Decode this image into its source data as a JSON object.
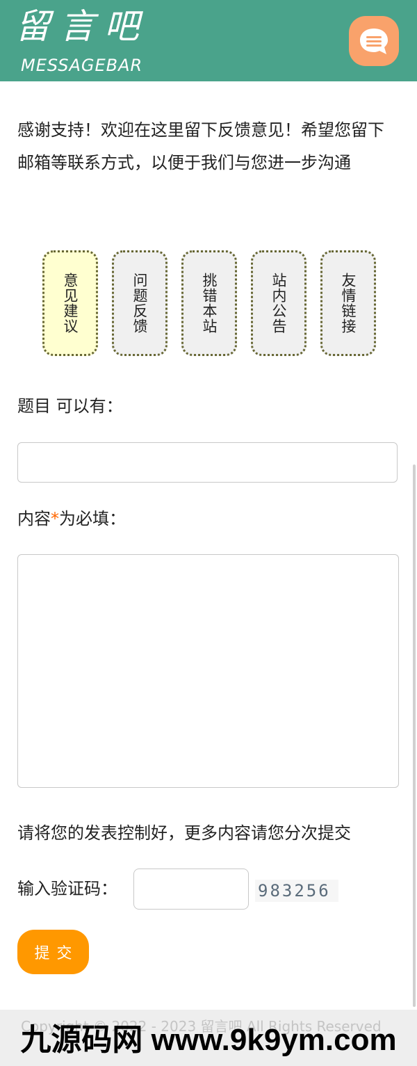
{
  "header": {
    "logo_cn": "留言吧",
    "logo_en": "MESSAGEBAR",
    "message_icon": "chat-bubble-icon",
    "colors": {
      "background": "#4aa38b",
      "button": "#f9a26b"
    }
  },
  "intro": "感谢支持！欢迎在这里留下反馈意见！希望您留下邮箱等联系方式，以便于我们与您进一步沟通",
  "tabs": [
    {
      "label": "意见建议",
      "active": true
    },
    {
      "label": "问题反馈",
      "active": false
    },
    {
      "label": "挑错本站",
      "active": false
    },
    {
      "label": "站内公告",
      "active": false
    },
    {
      "label": "友情链接",
      "active": false
    }
  ],
  "form": {
    "title_label": "题目 可以有：",
    "title_value": "",
    "content_label_prefix": "内容",
    "content_required_mark": "*",
    "content_label_suffix": "为必填：",
    "content_value": "",
    "notice": "请将您的发表控制好，更多内容请您分次提交",
    "captcha_label": "输入验证码：",
    "captcha_value": "",
    "captcha_text": "983256",
    "submit_label": "提交"
  },
  "footer": {
    "copyright": "Copyright © 2022 - 2023 留言吧 All Rights Reserved"
  },
  "watermark": "九源码网 www.9k9ym.com",
  "colors": {
    "accent": "#ff9800",
    "required": "#ff6600",
    "tab_border": "#666633",
    "tab_active_bg": "#ffffd0"
  }
}
